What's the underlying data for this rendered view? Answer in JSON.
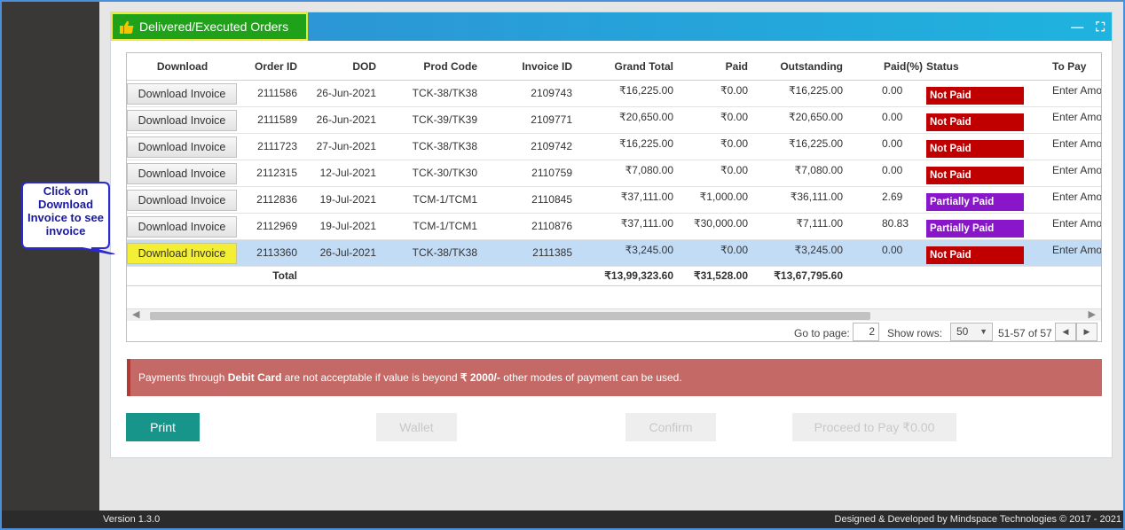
{
  "panel": {
    "title": "Delivered/Executed Orders",
    "minimize_icon": "minimize-icon",
    "fullscreen_icon": "fullscreen-icon"
  },
  "colors": {
    "header_gradient_start": "#2f8fd3",
    "header_gradient_end": "#1fb3df",
    "title_bg": "#1fa21a",
    "not_paid": "#c00000",
    "partially_paid": "#8a16c9",
    "selected_row": "#c3dcf6",
    "notice_bg": "#c46965",
    "print_button": "#17958a"
  },
  "table": {
    "columns": [
      "Download",
      "Order ID",
      "DOD",
      "Prod Code",
      "Invoice ID",
      "Grand Total",
      "Paid",
      "Outstanding",
      "Paid(%)",
      "Status",
      "To Pay"
    ],
    "rows": [
      {
        "download": "Download Invoice",
        "order_id": "2111586",
        "dod": "26-Jun-2021",
        "prod_code": "TCK-38/TK38",
        "invoice_id": "2109743",
        "grand_total": "₹16,225.00",
        "paid": "₹0.00",
        "outstanding": "₹16,225.00",
        "paid_pct": "0.00",
        "status": "Not Paid",
        "status_kind": "not-paid",
        "to_pay": "Enter Amount"
      },
      {
        "download": "Download Invoice",
        "order_id": "2111589",
        "dod": "26-Jun-2021",
        "prod_code": "TCK-39/TK39",
        "invoice_id": "2109771",
        "grand_total": "₹20,650.00",
        "paid": "₹0.00",
        "outstanding": "₹20,650.00",
        "paid_pct": "0.00",
        "status": "Not Paid",
        "status_kind": "not-paid",
        "to_pay": "Enter Amount"
      },
      {
        "download": "Download Invoice",
        "order_id": "2111723",
        "dod": "27-Jun-2021",
        "prod_code": "TCK-38/TK38",
        "invoice_id": "2109742",
        "grand_total": "₹16,225.00",
        "paid": "₹0.00",
        "outstanding": "₹16,225.00",
        "paid_pct": "0.00",
        "status": "Not Paid",
        "status_kind": "not-paid",
        "to_pay": "Enter Amount"
      },
      {
        "download": "Download Invoice",
        "order_id": "2112315",
        "dod": "12-Jul-2021",
        "prod_code": "TCK-30/TK30",
        "invoice_id": "2110759",
        "grand_total": "₹7,080.00",
        "paid": "₹0.00",
        "outstanding": "₹7,080.00",
        "paid_pct": "0.00",
        "status": "Not Paid",
        "status_kind": "not-paid",
        "to_pay": "Enter Amount"
      },
      {
        "download": "Download Invoice",
        "order_id": "2112836",
        "dod": "19-Jul-2021",
        "prod_code": "TCM-1/TCM1",
        "invoice_id": "2110845",
        "grand_total": "₹37,111.00",
        "paid": "₹1,000.00",
        "outstanding": "₹36,111.00",
        "paid_pct": "2.69",
        "status": "Partially Paid",
        "status_kind": "partial",
        "to_pay": "Enter Amount"
      },
      {
        "download": "Download Invoice",
        "order_id": "2112969",
        "dod": "19-Jul-2021",
        "prod_code": "TCM-1/TCM1",
        "invoice_id": "2110876",
        "grand_total": "₹37,111.00",
        "paid": "₹30,000.00",
        "outstanding": "₹7,111.00",
        "paid_pct": "80.83",
        "status": "Partially Paid",
        "status_kind": "partial",
        "to_pay": "Enter Amount"
      },
      {
        "download": "Download Invoice",
        "order_id": "2113360",
        "dod": "26-Jul-2021",
        "prod_code": "TCK-38/TK38",
        "invoice_id": "2111385",
        "grand_total": "₹3,245.00",
        "paid": "₹0.00",
        "outstanding": "₹3,245.00",
        "paid_pct": "0.00",
        "status": "Not Paid",
        "status_kind": "not-paid",
        "to_pay": "Enter Amount",
        "selected": true
      }
    ],
    "total": {
      "label": "Total",
      "grand_total": "₹13,99,323.60",
      "paid": "₹31,528.00",
      "outstanding": "₹13,67,795.60",
      "to_pay": "₹"
    }
  },
  "pager": {
    "goto_label": "Go to page:",
    "page_value": "2",
    "rows_label": "Show rows:",
    "rows_value": "50",
    "range_text": "51-57 of 57"
  },
  "notice": {
    "prefix": "Payments through ",
    "bold1": "Debit Card",
    "middle": " are not acceptable if value is beyond ",
    "bold2": "₹ 2000/-",
    "suffix": " other modes of payment can be used."
  },
  "buttons": {
    "print": "Print",
    "wallet": "Wallet",
    "confirm": "Confirm",
    "proceed": "Proceed to Pay ₹0.00"
  },
  "callout": {
    "text": "Click on Download Invoice to see invoice"
  },
  "footer": {
    "version": "Version 1.3.0",
    "credit": "Designed & Developed by Mindspace Technologies © 2017 - 2021"
  }
}
